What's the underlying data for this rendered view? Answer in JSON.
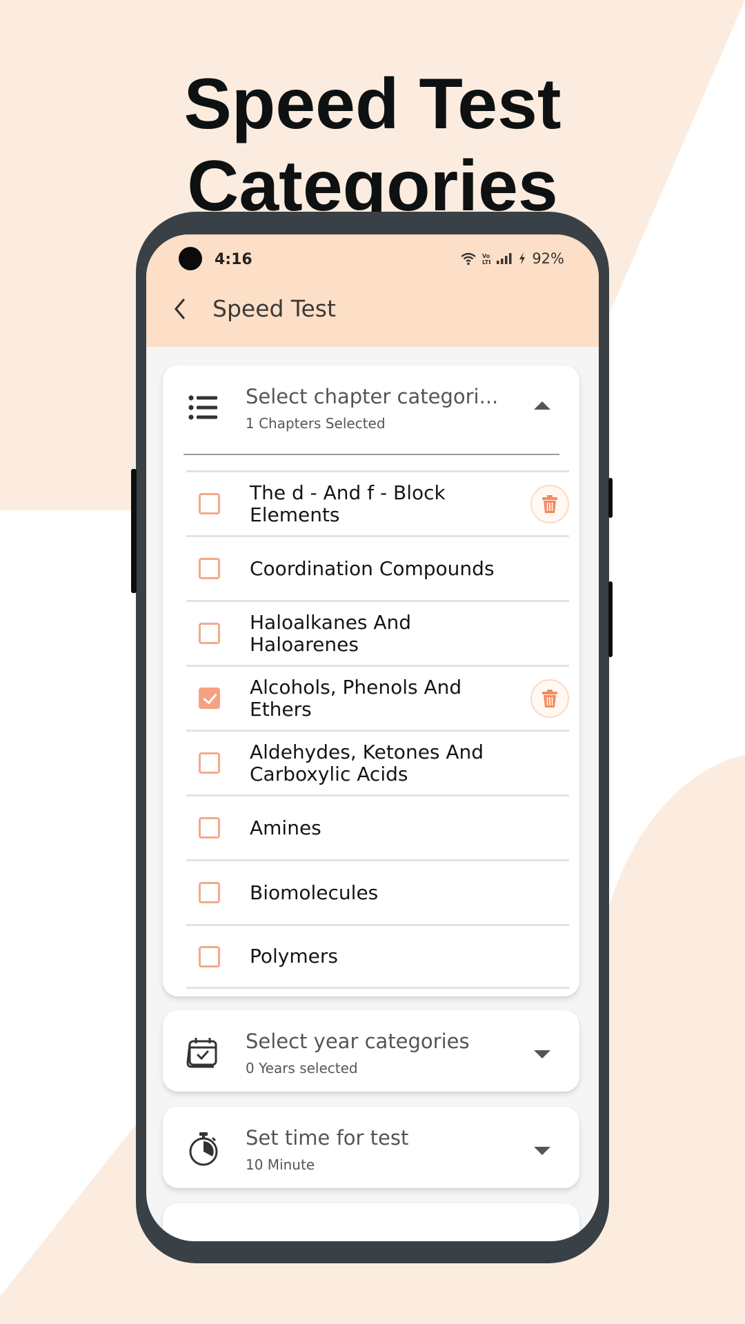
{
  "headline": "Speed Test Categories",
  "status_bar": {
    "time": "4:16",
    "battery": "92%",
    "icons": [
      "wifi-icon",
      "volte-icon",
      "signal-icon",
      "charging-icon"
    ]
  },
  "app_bar": {
    "back_icon": "chevron-left-icon",
    "title": "Speed Test"
  },
  "chapter_card": {
    "icon": "list-icon",
    "title": "Select chapter categori...",
    "subtitle": "1 Chapters Selected",
    "expanded": true,
    "items": [
      {
        "label": "The d - And f - Block Elements",
        "checked": false,
        "has_delete": true
      },
      {
        "label": "Coordination Compounds",
        "checked": false,
        "has_delete": false
      },
      {
        "label": "Haloalkanes And Haloarenes",
        "checked": false,
        "has_delete": false
      },
      {
        "label": "Alcohols, Phenols And Ethers",
        "checked": true,
        "has_delete": true
      },
      {
        "label": "Aldehydes, Ketones And Carboxylic Acids",
        "checked": false,
        "has_delete": false
      },
      {
        "label": "Amines",
        "checked": false,
        "has_delete": false
      },
      {
        "label": "Biomolecules",
        "checked": false,
        "has_delete": false
      },
      {
        "label": "Polymers",
        "checked": false,
        "has_delete": false
      }
    ]
  },
  "year_card": {
    "icon": "calendar-check-icon",
    "title": "Select year categories",
    "subtitle": "0 Years selected"
  },
  "time_card": {
    "icon": "stopwatch-icon",
    "title": "Set time for test",
    "subtitle": "10 Minute"
  },
  "colors": {
    "background_accent": "#fcece0",
    "app_bar": "#fcdfc6",
    "checkbox_accent": "#f7a183",
    "phone_frame": "#394146"
  }
}
